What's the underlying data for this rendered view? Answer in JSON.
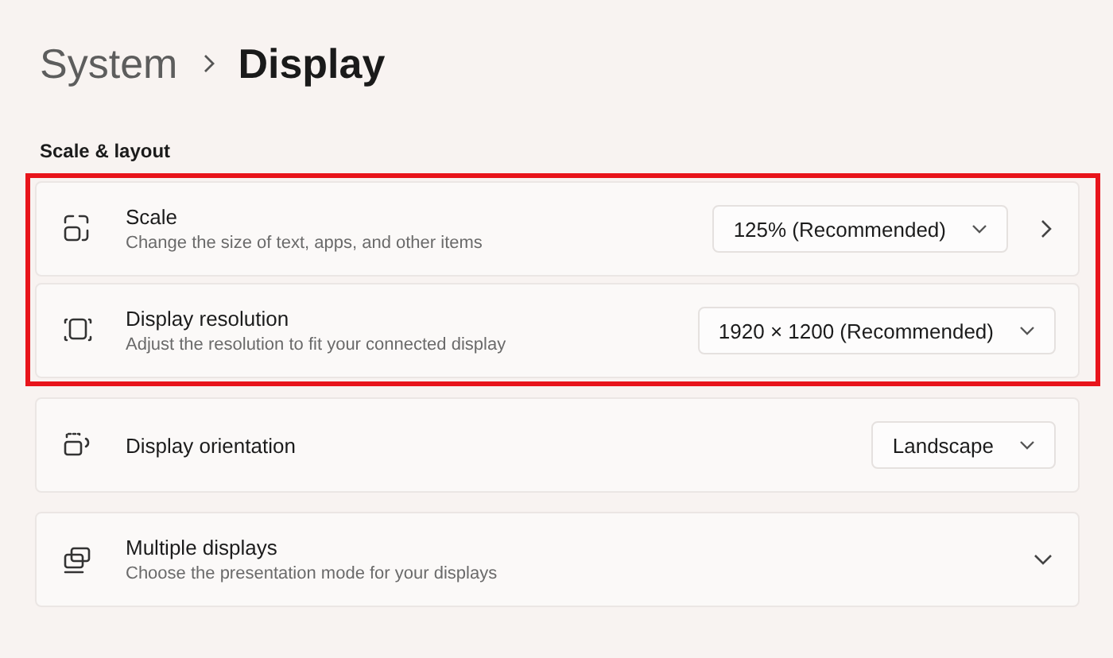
{
  "breadcrumb": [
    {
      "label": "System",
      "current": false
    },
    {
      "label": "Display",
      "current": true
    }
  ],
  "section_title": "Scale & layout",
  "groups": [
    {
      "highlighted": true,
      "rows": [
        {
          "kind": "link",
          "title": "Scale",
          "subtitle": "Change the size of text, apps, and other items",
          "dropdown": "125% (Recommended)"
        },
        {
          "kind": "plain",
          "title": "Display resolution",
          "subtitle": "Adjust the resolution to fit your connected display",
          "dropdown": "1920 × 1200 (Recommended)"
        }
      ]
    },
    {
      "highlighted": false,
      "rows": [
        {
          "kind": "plain",
          "title": "Display orientation",
          "dropdown": "Landscape"
        }
      ]
    },
    {
      "highlighted": false,
      "rows": [
        {
          "kind": "expander",
          "title": "Multiple displays",
          "subtitle": "Choose the presentation mode for your displays",
          "expanded": false
        }
      ]
    }
  ]
}
